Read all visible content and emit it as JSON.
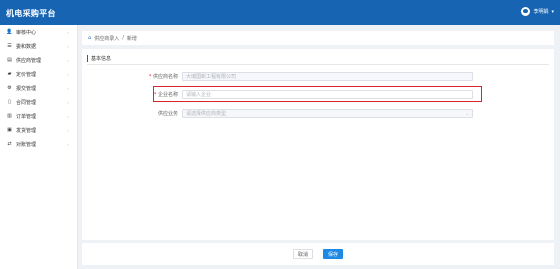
{
  "header": {
    "title": "机电采购平台",
    "user_name": "李明娟",
    "user_caret": "▾"
  },
  "sidebar": {
    "items": [
      {
        "label": "审核中心",
        "icon": "user-icon",
        "glyph": "👤",
        "chevron": "›"
      },
      {
        "label": "委和数据",
        "icon": "list-icon",
        "glyph": "☰",
        "chevron": "›"
      },
      {
        "label": "供应商管理",
        "icon": "document-icon",
        "glyph": "▤",
        "chevron": "›"
      },
      {
        "label": "定价管理",
        "icon": "folder-icon",
        "glyph": "▰",
        "chevron": "›"
      },
      {
        "label": "报交管理",
        "icon": "gear-icon",
        "glyph": "⚙",
        "chevron": "›"
      },
      {
        "label": "合同管理",
        "icon": "contract-icon",
        "glyph": "▯",
        "chevron": "›"
      },
      {
        "label": "订单管理",
        "icon": "order-icon",
        "glyph": "▥",
        "chevron": "›"
      },
      {
        "label": "发货管理",
        "icon": "truck-icon",
        "glyph": "▣",
        "chevron": "›"
      },
      {
        "label": "对账管理",
        "icon": "reconcile-icon",
        "glyph": "⇄",
        "chevron": "›"
      }
    ]
  },
  "breadcrumb": {
    "home_glyph": "⌂",
    "parent": "供应商录入",
    "separator": "/",
    "current": "新增"
  },
  "form": {
    "section_title": "基本信息",
    "fields": [
      {
        "required_mark": "*",
        "label": "供应商名称",
        "value": "大瑞国新工程有限公司"
      },
      {
        "required_mark": "*",
        "label": "企业名称",
        "placeholder": "请输入企业"
      },
      {
        "required_mark": "",
        "label": "供应业务",
        "placeholder": "请选择供应商类型",
        "arrow": "⌄"
      }
    ]
  },
  "actions": {
    "cancel_label": "取消",
    "save_label": "保存"
  },
  "colors": {
    "header_bg": "#1764b3",
    "highlight": "#d9232e",
    "primary_button": "#1e88e5"
  }
}
